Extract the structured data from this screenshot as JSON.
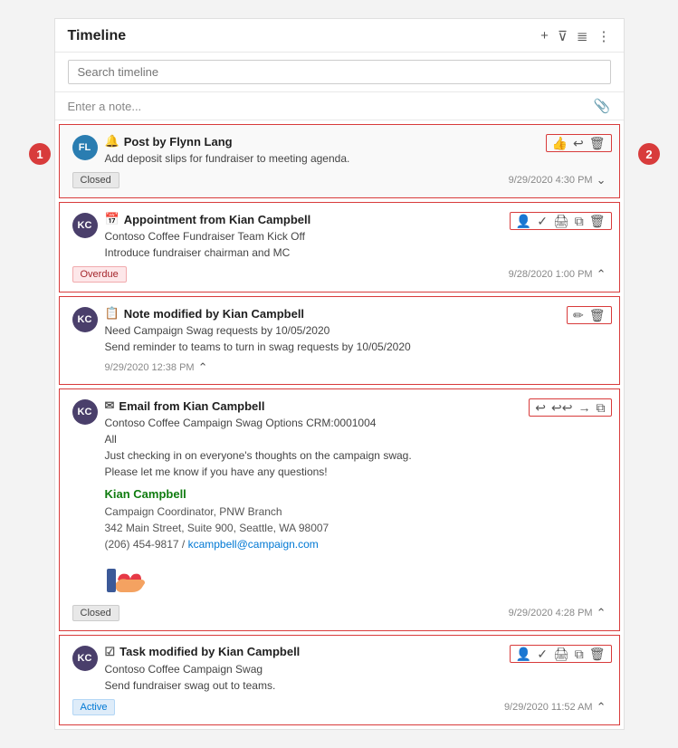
{
  "panel": {
    "title": "Timeline",
    "search_placeholder": "Search timeline",
    "note_placeholder": "Enter a note...",
    "header_icons": {
      "add": "+",
      "filter": "⊿",
      "sort": "≡",
      "more": "⋮"
    }
  },
  "annotations": {
    "circle1_label": "1",
    "circle2_label": "2"
  },
  "items": [
    {
      "id": "post-1",
      "avatar_initials": "FL",
      "avatar_class": "avatar-fl",
      "type_icon": "🔔",
      "type_label": "Post",
      "author": "Flynn Lang",
      "title": "Post by Flynn Lang",
      "body1": "Add deposit slips for fundraiser to meeting agenda.",
      "badge": "Closed",
      "badge_class": "badge-closed",
      "timestamp": "9/29/2020 4:30 PM",
      "actions": [
        "thumbs_up",
        "reply",
        "delete"
      ]
    },
    {
      "id": "appointment-1",
      "avatar_initials": "KC",
      "avatar_class": "avatar-kc",
      "type_icon": "📅",
      "type_label": "Appointment",
      "author": "Kian Campbell",
      "title": "Appointment from Kian Campbell",
      "body1": "Contoso Coffee Fundraiser Team Kick Off",
      "body2": "Introduce fundraiser chairman and MC",
      "badge": "Overdue",
      "badge_class": "badge-overdue",
      "timestamp": "9/28/2020 1:00 PM",
      "actions": [
        "assign",
        "complete",
        "print",
        "convert",
        "delete"
      ]
    },
    {
      "id": "note-1",
      "avatar_initials": "KC",
      "avatar_class": "avatar-kc",
      "type_icon": "📋",
      "type_label": "Note",
      "author": "Kian Campbell",
      "title": "Note modified by Kian Campbell",
      "body1": "Need Campaign Swag requests by 10/05/2020",
      "body2": "Send reminder to teams to turn in swag requests by 10/05/2020",
      "timestamp": "9/29/2020 12:38 PM",
      "actions": [
        "edit",
        "delete"
      ]
    },
    {
      "id": "email-1",
      "avatar_initials": "KC",
      "avatar_class": "avatar-kc",
      "type_icon": "✉",
      "type_label": "Email",
      "author": "Kian Campbell",
      "title": "Email from Kian Campbell",
      "body1": "Contoso Coffee Campaign Swag Options CRM:0001004",
      "body2": "All",
      "body3": "Just checking in on everyone's thoughts on the campaign swag.",
      "body4": "Please let me know if you have any questions!",
      "signature_name": "Kian Campbell",
      "signature_title": "Campaign Coordinator, PNW Branch",
      "signature_address": "342 Main Street, Suite 900, Seattle, WA 98007",
      "signature_phone": "(206) 454-9817",
      "signature_email": "kcampbell@campaign.com",
      "badge": "Closed",
      "badge_class": "badge-closed",
      "timestamp": "9/29/2020 4:28 PM",
      "actions": [
        "reply",
        "reply_all",
        "forward",
        "convert"
      ]
    },
    {
      "id": "task-1",
      "avatar_initials": "KC",
      "avatar_class": "avatar-kc",
      "type_icon": "✓",
      "type_label": "Task",
      "author": "Kian Campbell",
      "title": "Task modified by Kian Campbell",
      "body1": "Contoso Coffee Campaign Swag",
      "body2": "Send fundraiser swag out to teams.",
      "badge": "Active",
      "badge_class": "badge-active",
      "timestamp": "9/29/2020 11:52 AM",
      "actions": [
        "assign",
        "complete",
        "print",
        "convert",
        "delete"
      ]
    }
  ]
}
